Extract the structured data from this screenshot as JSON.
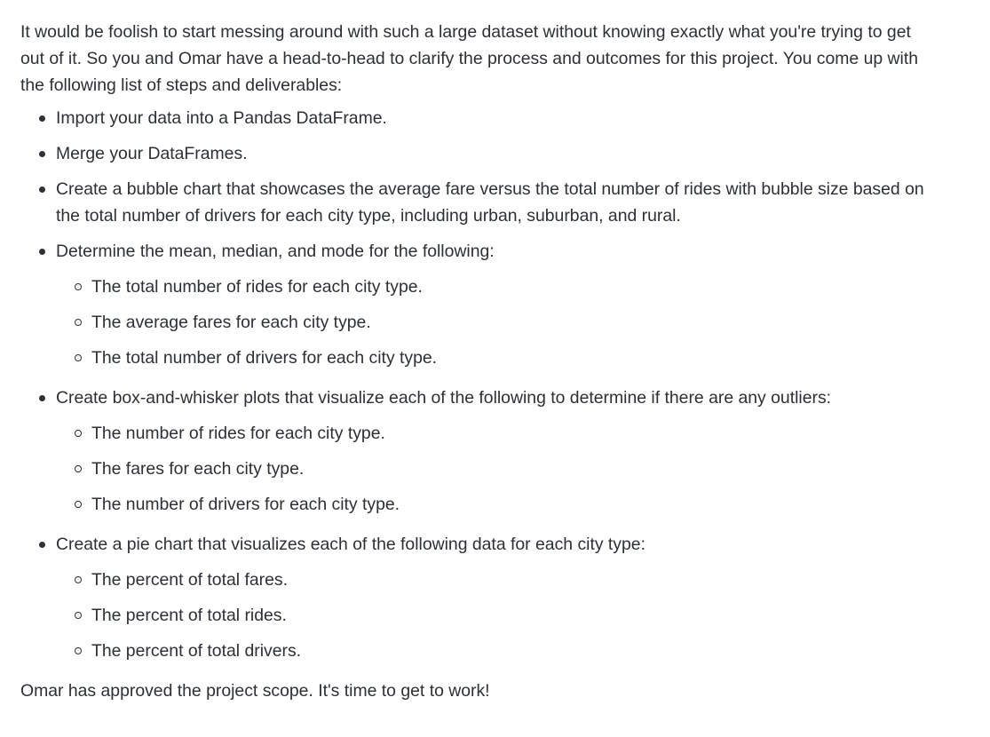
{
  "intro": "It would be foolish to start messing around with such a large dataset without knowing exactly what you're trying to get out of it. So you and Omar have a head-to-head to clarify the process and outcomes for this project. You come up with the following list of steps and deliverables:",
  "steps": [
    {
      "text": "Import your data into a Pandas DataFrame."
    },
    {
      "text": "Merge your DataFrames."
    },
    {
      "text": "Create a bubble chart that showcases the average fare versus the total number of rides with bubble size based on the total number of drivers for each city type, including urban, suburban, and rural."
    },
    {
      "text": "Determine the mean, median, and mode for the following:",
      "sub": [
        "The total number of rides for each city type.",
        "The average fares for each city type.",
        "The total number of drivers for each city type."
      ]
    },
    {
      "text": "Create box-and-whisker plots that visualize each of the following to determine if there are any outliers:",
      "sub": [
        "The number of rides for each city type.",
        "The fares for each city type.",
        "The number of drivers for each city type."
      ]
    },
    {
      "text": "Create a pie chart that visualizes each of the following data for each city type:",
      "sub": [
        "The percent of total fares.",
        "The percent of total rides.",
        "The percent of total drivers."
      ]
    }
  ],
  "outro": "Omar has approved the project scope. It's time to get to work!"
}
